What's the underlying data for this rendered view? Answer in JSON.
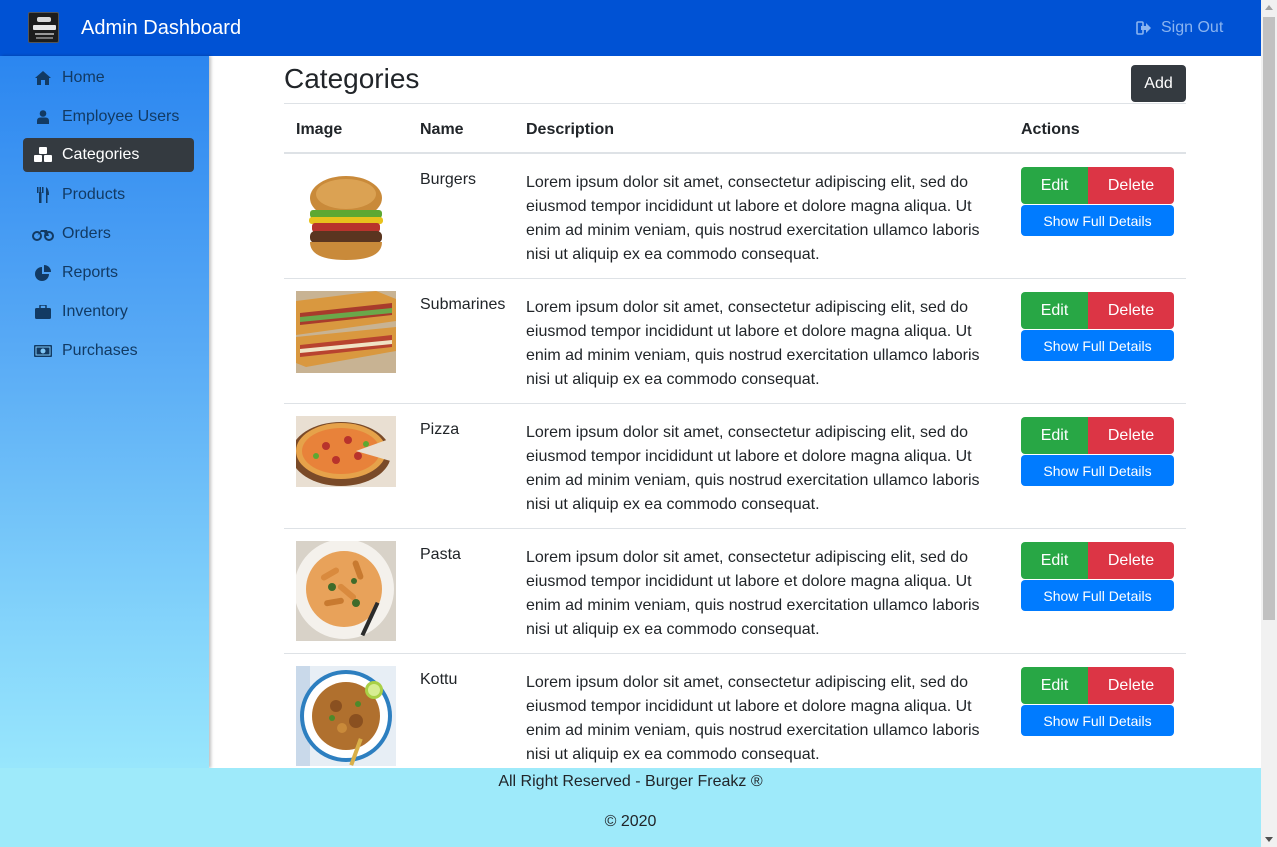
{
  "header": {
    "brand": "Admin Dashboard",
    "sign_out": "Sign Out"
  },
  "sidebar": {
    "items": [
      {
        "label": "Home",
        "icon": "home-icon"
      },
      {
        "label": "Employee Users",
        "icon": "user-icon"
      },
      {
        "label": "Categories",
        "icon": "cubes-icon",
        "active": true
      },
      {
        "label": "Products",
        "icon": "utensils-icon"
      },
      {
        "label": "Orders",
        "icon": "motorcycle-icon"
      },
      {
        "label": "Reports",
        "icon": "pie-chart-icon"
      },
      {
        "label": "Inventory",
        "icon": "briefcase-icon"
      },
      {
        "label": "Purchases",
        "icon": "money-bill-icon"
      }
    ]
  },
  "main": {
    "title": "Categories",
    "add_label": "Add",
    "columns": [
      "Image",
      "Name",
      "Description",
      "Actions"
    ],
    "rows": [
      {
        "name": "Burgers",
        "image": "burger-image",
        "description": "Lorem ipsum dolor sit amet, consectetur adipiscing elit, sed do eiusmod tempor incididunt ut labore et dolore magna aliqua. Ut enim ad minim veniam, quis nostrud exercitation ullamco laboris nisi ut aliquip ex ea commodo consequat."
      },
      {
        "name": "Submarines",
        "image": "submarine-image",
        "description": "Lorem ipsum dolor sit amet, consectetur adipiscing elit, sed do eiusmod tempor incididunt ut labore et dolore magna aliqua. Ut enim ad minim veniam, quis nostrud exercitation ullamco laboris nisi ut aliquip ex ea commodo consequat."
      },
      {
        "name": "Pizza",
        "image": "pizza-image",
        "description": "Lorem ipsum dolor sit amet, consectetur adipiscing elit, sed do eiusmod tempor incididunt ut labore et dolore magna aliqua. Ut enim ad minim veniam, quis nostrud exercitation ullamco laboris nisi ut aliquip ex ea commodo consequat."
      },
      {
        "name": "Pasta",
        "image": "pasta-image",
        "description": "Lorem ipsum dolor sit amet, consectetur adipiscing elit, sed do eiusmod tempor incididunt ut labore et dolore magna aliqua. Ut enim ad minim veniam, quis nostrud exercitation ullamco laboris nisi ut aliquip ex ea commodo consequat."
      },
      {
        "name": "Kottu",
        "image": "kottu-image",
        "description": "Lorem ipsum dolor sit amet, consectetur adipiscing elit, sed do eiusmod tempor incididunt ut labore et dolore magna aliqua. Ut enim ad minim veniam, quis nostrud exercitation ullamco laboris nisi ut aliquip ex ea commodo consequat."
      }
    ],
    "actions": {
      "edit": "Edit",
      "delete": "Delete",
      "details": "Show Full Details"
    }
  },
  "footer": {
    "rights": "All Right Reserved - Burger Freakz ®",
    "copyright": "© 2020"
  },
  "colors": {
    "navbar": "#0052d4",
    "active_item": "#343a40",
    "edit": "#28a745",
    "delete": "#dc3545",
    "details": "#007bff",
    "footer": "#9eeafa"
  }
}
